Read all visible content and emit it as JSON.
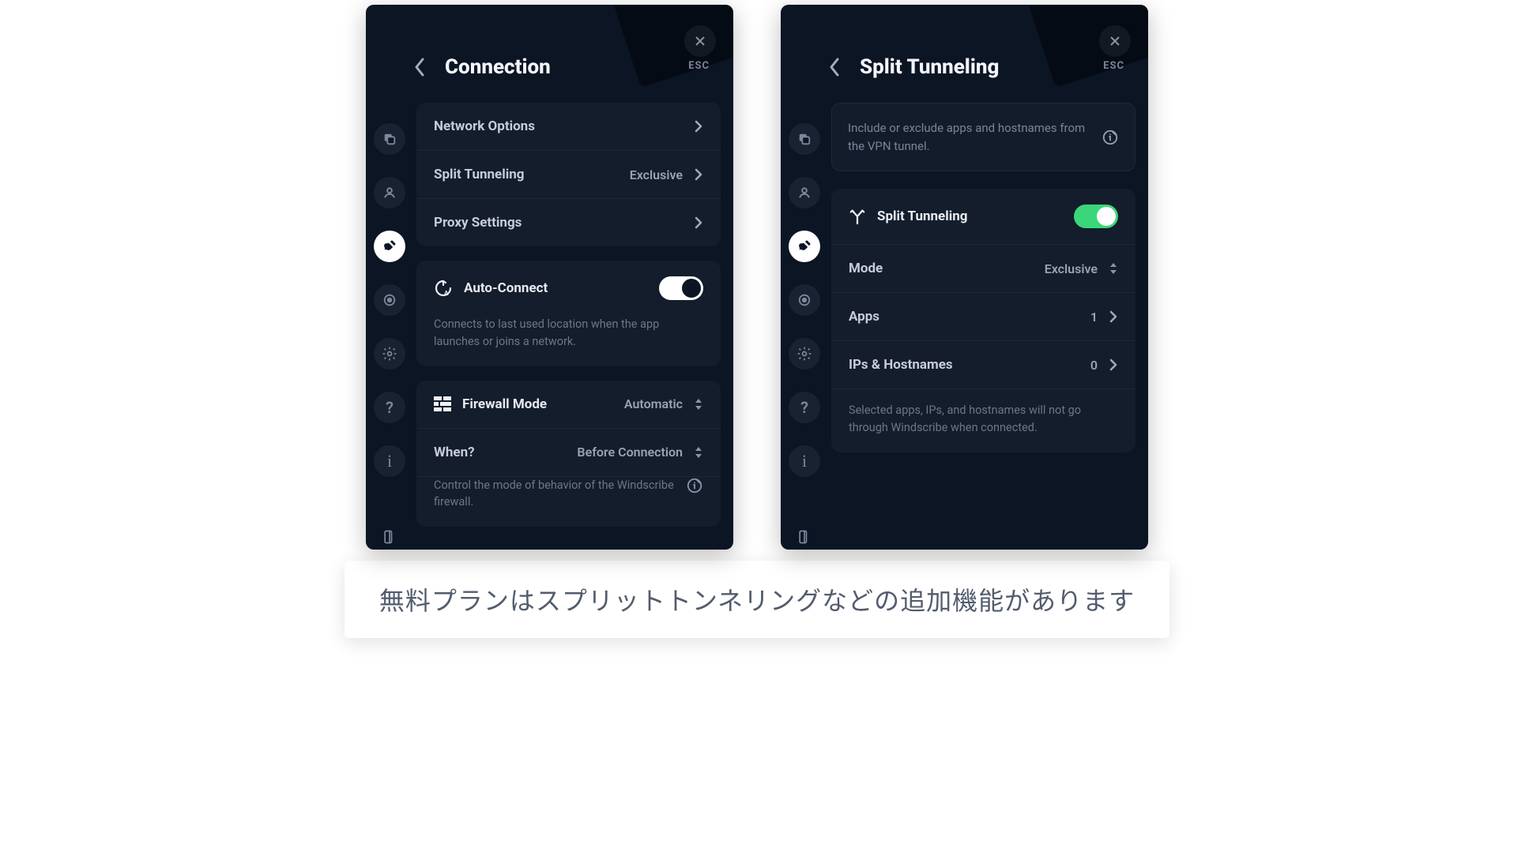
{
  "esc_label": "ESC",
  "window_left": {
    "title": "Connection",
    "nav_items": [
      {
        "label": "Network Options",
        "value": ""
      },
      {
        "label": "Split Tunneling",
        "value": "Exclusive"
      },
      {
        "label": "Proxy Settings",
        "value": ""
      }
    ],
    "autoconnect": {
      "title": "Auto-Connect",
      "desc": "Connects to last used location when the app launches or joins a network."
    },
    "firewall": {
      "title": "Firewall Mode",
      "mode_value": "Automatic",
      "when_label": "When?",
      "when_value": "Before Connection",
      "desc": "Control the mode of behavior of the Windscribe firewall."
    }
  },
  "window_right": {
    "title": "Split Tunneling",
    "infobox": "Include or exclude apps and hostnames from the VPN tunnel.",
    "toggle_label": "Split Tunneling",
    "mode_label": "Mode",
    "mode_value": "Exclusive",
    "apps_label": "Apps",
    "apps_value": "1",
    "hosts_label": "IPs & Hostnames",
    "hosts_value": "0",
    "footnote": "Selected apps, IPs, and hostnames will not go through Windscribe when connected."
  },
  "caption": "無料プランはスプリットトンネリングなどの追加機能があります",
  "colors": {
    "accent_green": "#3bd67a"
  }
}
